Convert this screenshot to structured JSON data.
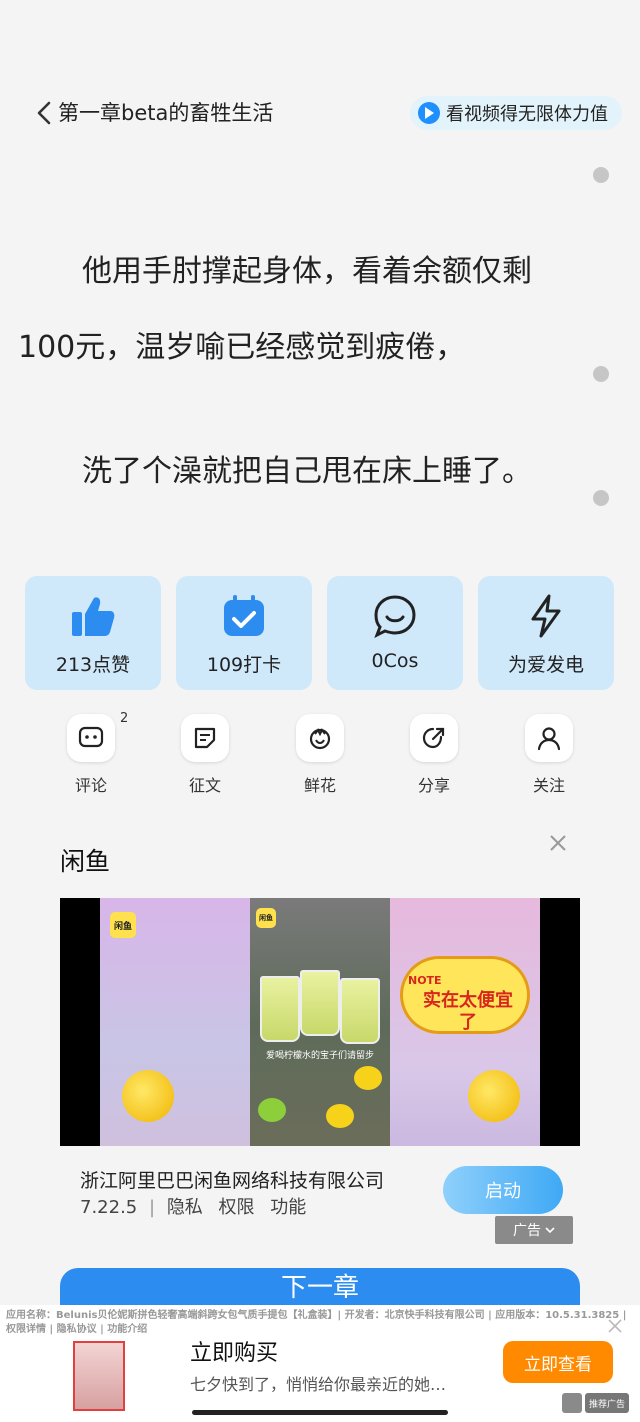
{
  "header": {
    "chapter_title": "第一章beta的畜牲生活",
    "video_pill": "看视频得无限体力值"
  },
  "content": {
    "line1": "他用手肘撑起身体，看着余额仅剩",
    "line2": "100元，温岁喻已经感觉到疲倦，",
    "line3": "洗了个澡就把自己甩在床上睡了。"
  },
  "actions": {
    "like": "213点赞",
    "checkin": "109打卡",
    "cos": "0Cos",
    "power": "为爱发电"
  },
  "small_actions": {
    "comment": "评论",
    "comment_badge": "2",
    "essay": "征文",
    "flower": "鲜花",
    "share": "分享",
    "follow": "关注"
  },
  "ad": {
    "title": "闲鱼",
    "logo_text": "闲鱼",
    "cloud_text": "实在太便宜了",
    "note_text": "NOTE",
    "video_caption": "爱喝柠檬水的宝子们请留步",
    "company": "浙江阿里巴巴闲鱼网络科技有限公司",
    "version": "7.22.5",
    "links": [
      "隐私",
      "权限",
      "功能"
    ],
    "launch": "启动",
    "ad_tag": "广告"
  },
  "next_button": "下一章",
  "bottom_ad": {
    "info": "应用名称：Belunis贝伦妮斯拼色轻奢高端斜跨女包气质手提包【礼盒装】| 开发者：北京快手科技有限公司 | 应用版本：10.5.31.3825 | 权限详情 | 隐私协议 | 功能介绍",
    "title": "立即购买",
    "subtitle": "七夕快到了，悄悄给你最亲近的她…",
    "cta": "立即查看",
    "rec": "推荐广告"
  },
  "colors": {
    "card_bg": "#cfe9fb",
    "accent_blue": "#2c8cf0",
    "cta_orange": "#ff8a00"
  }
}
